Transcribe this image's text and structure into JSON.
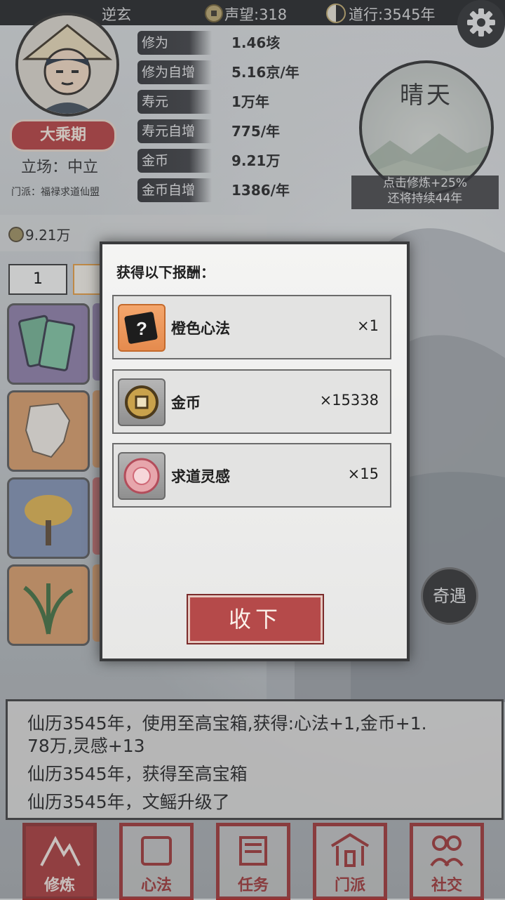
{
  "topbar": {
    "name": "逆玄",
    "fame_label": "声望:318",
    "dao_label": "道行:3545年"
  },
  "profile": {
    "realm": "大乘期",
    "stance": "立场：中立",
    "sect": "门派：福禄求道仙盟"
  },
  "stats": [
    {
      "label": "修为",
      "value": "1.46垓"
    },
    {
      "label": "修为自增",
      "value": "5.16京/年"
    },
    {
      "label": "寿元",
      "value": "1万年"
    },
    {
      "label": "寿元自增",
      "value": "775/年"
    },
    {
      "label": "金币",
      "value": "9.21万"
    },
    {
      "label": "金币自增",
      "value": "1386/年"
    }
  ],
  "weather": {
    "title": "晴天",
    "line1": "点击修炼+25%",
    "line2": "还将持续44年"
  },
  "left": {
    "gold": "9.21万",
    "qty": "1"
  },
  "dialog": {
    "title": "获得以下报酬：",
    "rewards": [
      {
        "name": "橙色心法",
        "count": "×1",
        "icon": "mystery-scroll-icon"
      },
      {
        "name": "金币",
        "count": "×15338",
        "icon": "coin-icon"
      },
      {
        "name": "求道灵感",
        "count": "×15",
        "icon": "inspiration-orb-icon"
      }
    ],
    "confirm": "收下"
  },
  "qiyu": "奇遇",
  "log": [
    "仙历3545年，使用至高宝箱,获得:心法+1,金币+1.",
    "78万,灵感+13",
    "仙历3545年，获得至高宝箱",
    "仙历3545年，文鳐升级了"
  ],
  "nav": [
    {
      "label": "修炼",
      "icon": "mountain-icon"
    },
    {
      "label": "心法",
      "icon": "scroll-icon"
    },
    {
      "label": "任务",
      "icon": "task-scroll-icon"
    },
    {
      "label": "门派",
      "icon": "temple-icon"
    },
    {
      "label": "社交",
      "icon": "people-icon"
    }
  ]
}
